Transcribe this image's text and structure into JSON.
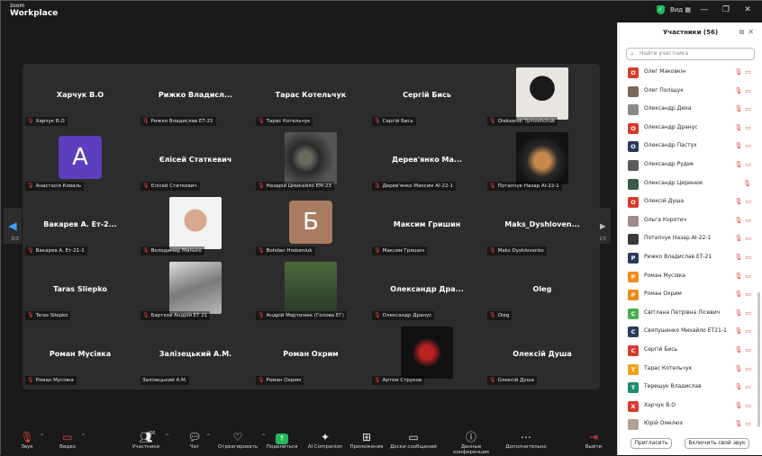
{
  "app": {
    "brand_top": "zoom",
    "brand_bottom": "Workplace",
    "view_label": "Вид"
  },
  "colors": {
    "accent": "#2f7bff",
    "muted_red": "#e5413a",
    "share_green": "#1fb95c"
  },
  "pager": {
    "left": "3/3",
    "right": "3/3"
  },
  "tiles": [
    {
      "name": "Харчук В.О",
      "label": "Харчук В.О"
    },
    {
      "name": "Рижко Владисл...",
      "label": "Рижко Владислав ЕТ-21"
    },
    {
      "name": "Тарас Котельчук",
      "label": "Тарас Котельчук"
    },
    {
      "name": "Сергій Бись",
      "label": "Сергій Бись"
    },
    {
      "name": "",
      "label": "Oleksandr Tymoshchuk"
    },
    {
      "name": "",
      "avatar": "А",
      "label": "Анастасія Коваль"
    },
    {
      "name": "Єлісей Статкевич",
      "label": "Єлісей Статкевич"
    },
    {
      "name": "",
      "label": "Назарій Цмикайло ЕМ-23"
    },
    {
      "name": "Дерев'янко Ма...",
      "label": "Дерев'янко Максим АІ-22-1"
    },
    {
      "name": "",
      "label": "Потапчук Назар АІ-22-1"
    },
    {
      "name": "Вакарев А. Ет-2...",
      "label": "Вакарев А. Ет-21-1"
    },
    {
      "name": "",
      "label": "Володимир Милько"
    },
    {
      "name": "",
      "avatar": "Б",
      "label": "Bohdan Hrebeniuk"
    },
    {
      "name": "Максим Гришин",
      "label": "Максим Гришин"
    },
    {
      "name": "Maks_Dyshloven...",
      "label": "Maks Dyshlovenko"
    },
    {
      "name": "Taras Sliepko",
      "label": "Taras Sliepko"
    },
    {
      "name": "",
      "label": "Бартков Андрій ЕТ 21"
    },
    {
      "name": "",
      "label": "Андрій Мартинюк (Голова ЕГ)"
    },
    {
      "name": "Олександр Дра...",
      "label": "Олександр Дранус"
    },
    {
      "name": "Oleg",
      "label": "Oleg"
    },
    {
      "name": "Роман Мусіяка",
      "label": "Роман Мусіяка"
    },
    {
      "name": "Залізецький А.М.",
      "label": "Залізецький А.М."
    },
    {
      "name": "Роман Охрим",
      "label": "Роман Охрим"
    },
    {
      "name": "",
      "label": "Артем Струков"
    },
    {
      "name": "Олексій Душа",
      "label": "Олексій Душа"
    }
  ],
  "toolbar": {
    "audio": "Звук",
    "video": "Видео",
    "participants": "Участники",
    "participants_count": "56",
    "chat": "Чат",
    "react": "Отреагировать",
    "share": "Поделиться",
    "ai": "AI Companion",
    "apps": "Приложения",
    "whiteboards": "Доски сообщений",
    "data": "Данные конференции",
    "more": "Дополнительно",
    "leave": "Выйти"
  },
  "panel": {
    "title": "Участники (56)",
    "search_placeholder": "Найти участника",
    "invite": "Пригласить",
    "unmute": "Включить свой звук",
    "participants": [
      {
        "initial": "О",
        "color": "#d93a2b",
        "name": "Олег Маковкін",
        "video": true
      },
      {
        "initial": "",
        "color": "#7a6a5a",
        "name": "Олег Поліщук",
        "video": true
      },
      {
        "initial": "",
        "color": "#8a8a8a",
        "name": "Олександр Диха",
        "video": true
      },
      {
        "initial": "О",
        "color": "#d93a2b",
        "name": "Олександр Дранус",
        "video": true
      },
      {
        "initial": "О",
        "color": "#2b3b5c",
        "name": "Олександр Пастух",
        "video": true
      },
      {
        "initial": "",
        "color": "#5a5a5a",
        "name": "Олександр Рудик",
        "video": true
      },
      {
        "initial": "",
        "color": "#3a5a4a",
        "name": "Олександр Циринюк",
        "video": false
      },
      {
        "initial": "О",
        "color": "#d93a2b",
        "name": "Олексій Душа",
        "video": true
      },
      {
        "initial": "",
        "color": "#a08a8a",
        "name": "Ольга Коротич",
        "video": true
      },
      {
        "initial": "",
        "color": "#3a3a3a",
        "name": "Потапчук Назар АІ-22-1",
        "video": true
      },
      {
        "initial": "Р",
        "color": "#2b3b5c",
        "name": "Рижко Владислав ЕТ-21",
        "video": true
      },
      {
        "initial": "Р",
        "color": "#f08a1a",
        "name": "Роман Мусіяка",
        "video": true
      },
      {
        "initial": "Р",
        "color": "#f08a1a",
        "name": "Роман Охрим",
        "video": true
      },
      {
        "initial": "С",
        "color": "#4caf50",
        "name": "Світлана Петрівна Лісевич",
        "video": true
      },
      {
        "initial": "С",
        "color": "#2b3b5c",
        "name": "Свяпушенко Михайло ЕТ21-1",
        "video": true
      },
      {
        "initial": "С",
        "color": "#d93a2b",
        "name": "Сергій Бись",
        "video": true
      },
      {
        "initial": "Т",
        "color": "#f0a21a",
        "name": "Тарас Котельчук",
        "video": true
      },
      {
        "initial": "Т",
        "color": "#1f8a70",
        "name": "Терещук Владислав",
        "video": true
      },
      {
        "initial": "Х",
        "color": "#d93a2b",
        "name": "Харчук В.О",
        "video": true
      },
      {
        "initial": "",
        "color": "#b0a090",
        "name": "Юрій Омелюх",
        "video": true
      }
    ]
  }
}
